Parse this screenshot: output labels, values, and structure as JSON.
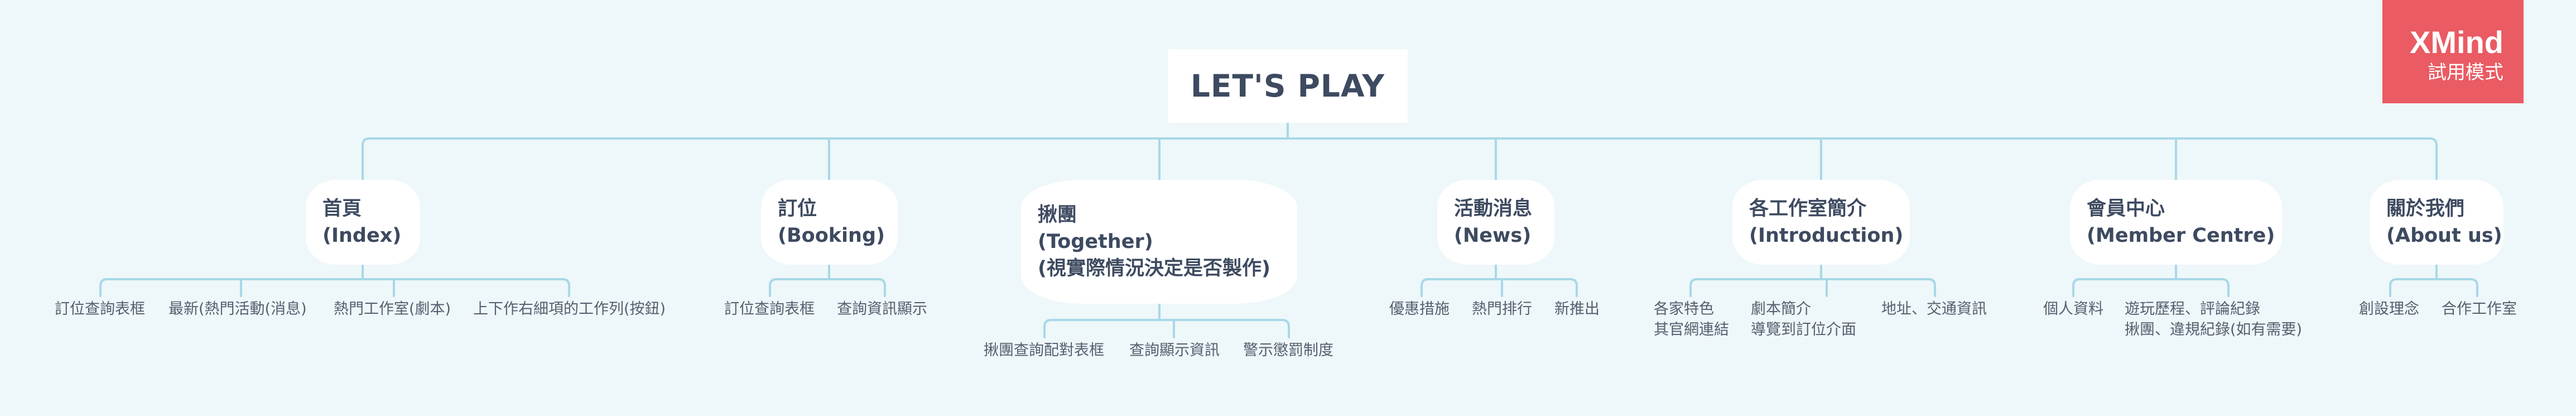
{
  "root": {
    "label": "LET'S PLAY"
  },
  "branches": [
    {
      "lines": [
        "首頁",
        "(Index)"
      ],
      "leaves": [
        [
          "訂位查詢表框"
        ],
        [
          "最新(熱門活動(消息)"
        ],
        [
          "熱門工作室(劇本)"
        ],
        [
          "上下作右細項的工作列(按鈕)"
        ]
      ]
    },
    {
      "lines": [
        "訂位",
        "(Booking)"
      ],
      "leaves": [
        [
          "訂位查詢表框"
        ],
        [
          "查詢資訊顯示"
        ]
      ]
    },
    {
      "lines": [
        "揪團",
        "(Together)",
        "(視實際情況決定是否製作)"
      ],
      "leaves": [
        [
          "揪團查詢配對表框"
        ],
        [
          "查詢顯示資訊"
        ],
        [
          "警示懲罰制度"
        ]
      ]
    },
    {
      "lines": [
        "活動消息",
        "(News)"
      ],
      "leaves": [
        [
          "優惠措施"
        ],
        [
          "熱門排行"
        ],
        [
          "新推出"
        ]
      ]
    },
    {
      "lines": [
        "各工作室簡介",
        "(Introduction)"
      ],
      "leaves": [
        [
          "各家特色",
          "其官網連結"
        ],
        [
          "劇本簡介",
          "導覽到訂位介面"
        ],
        [
          "地址、交通資訊"
        ]
      ]
    },
    {
      "lines": [
        "會員中心",
        "(Member Centre)"
      ],
      "leaves": [
        [
          "個人資料"
        ],
        [
          "遊玩歷程、評論紀錄",
          "揪團、違規紀錄(如有需要)"
        ]
      ]
    },
    {
      "lines": [
        "關於我們",
        "(About us)"
      ],
      "leaves": [
        [
          "創設理念"
        ],
        [
          "合作工作室"
        ]
      ]
    }
  ],
  "watermark": {
    "brand": "XMind",
    "mode": "試用模式"
  },
  "colors": {
    "background": "#eef7f9",
    "connector": "#a8d8e8",
    "node_text": "#3d4a60",
    "watermark": "#ea5b63"
  }
}
